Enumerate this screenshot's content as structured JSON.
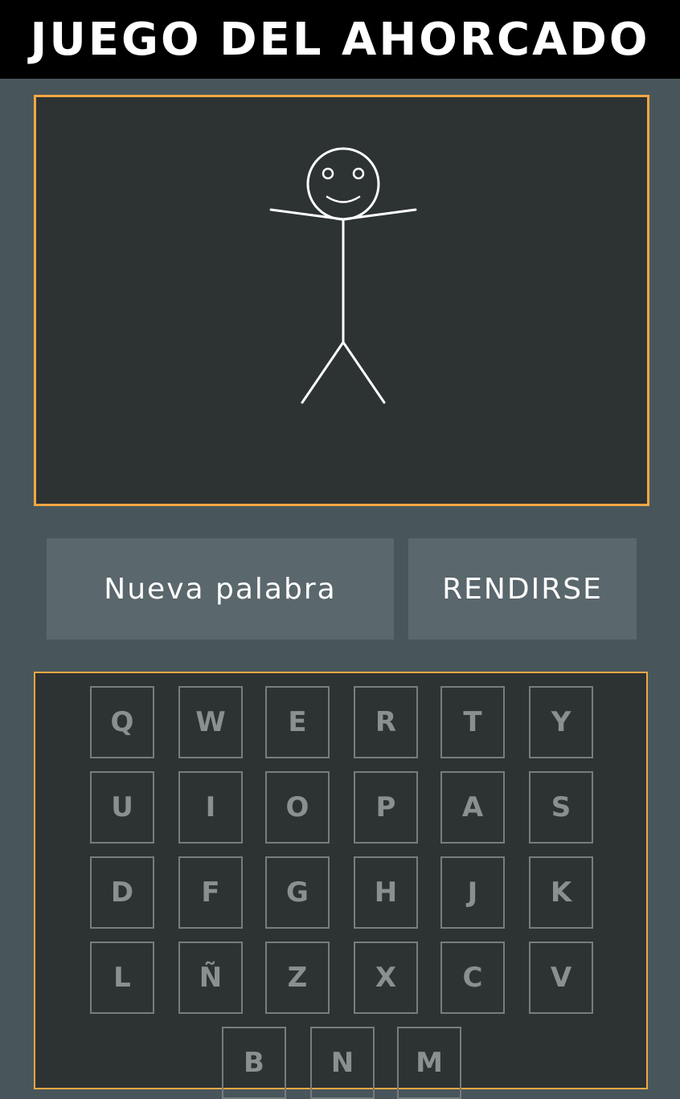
{
  "header": {
    "title": "JUEGO DEL AHORCADO"
  },
  "colors": {
    "accent": "#f5a742",
    "page_bg": "#48565b",
    "panel_bg": "#2d3233",
    "button_bg": "#5a676c",
    "key_border": "#777c7d",
    "figure_stroke": "#ffffff"
  },
  "drawing": {
    "figure": "stick-figure-smiling"
  },
  "actions": {
    "new_word_label": "Nueva palabra",
    "give_up_label": "RENDIRSE"
  },
  "keyboard": {
    "rows": [
      [
        "Q",
        "W",
        "E",
        "R",
        "T",
        "Y"
      ],
      [
        "U",
        "I",
        "O",
        "P",
        "A",
        "S"
      ],
      [
        "D",
        "F",
        "G",
        "H",
        "J",
        "K"
      ],
      [
        "L",
        "Ñ",
        "Z",
        "X",
        "C",
        "V"
      ],
      [
        "B",
        "N",
        "M"
      ]
    ]
  }
}
